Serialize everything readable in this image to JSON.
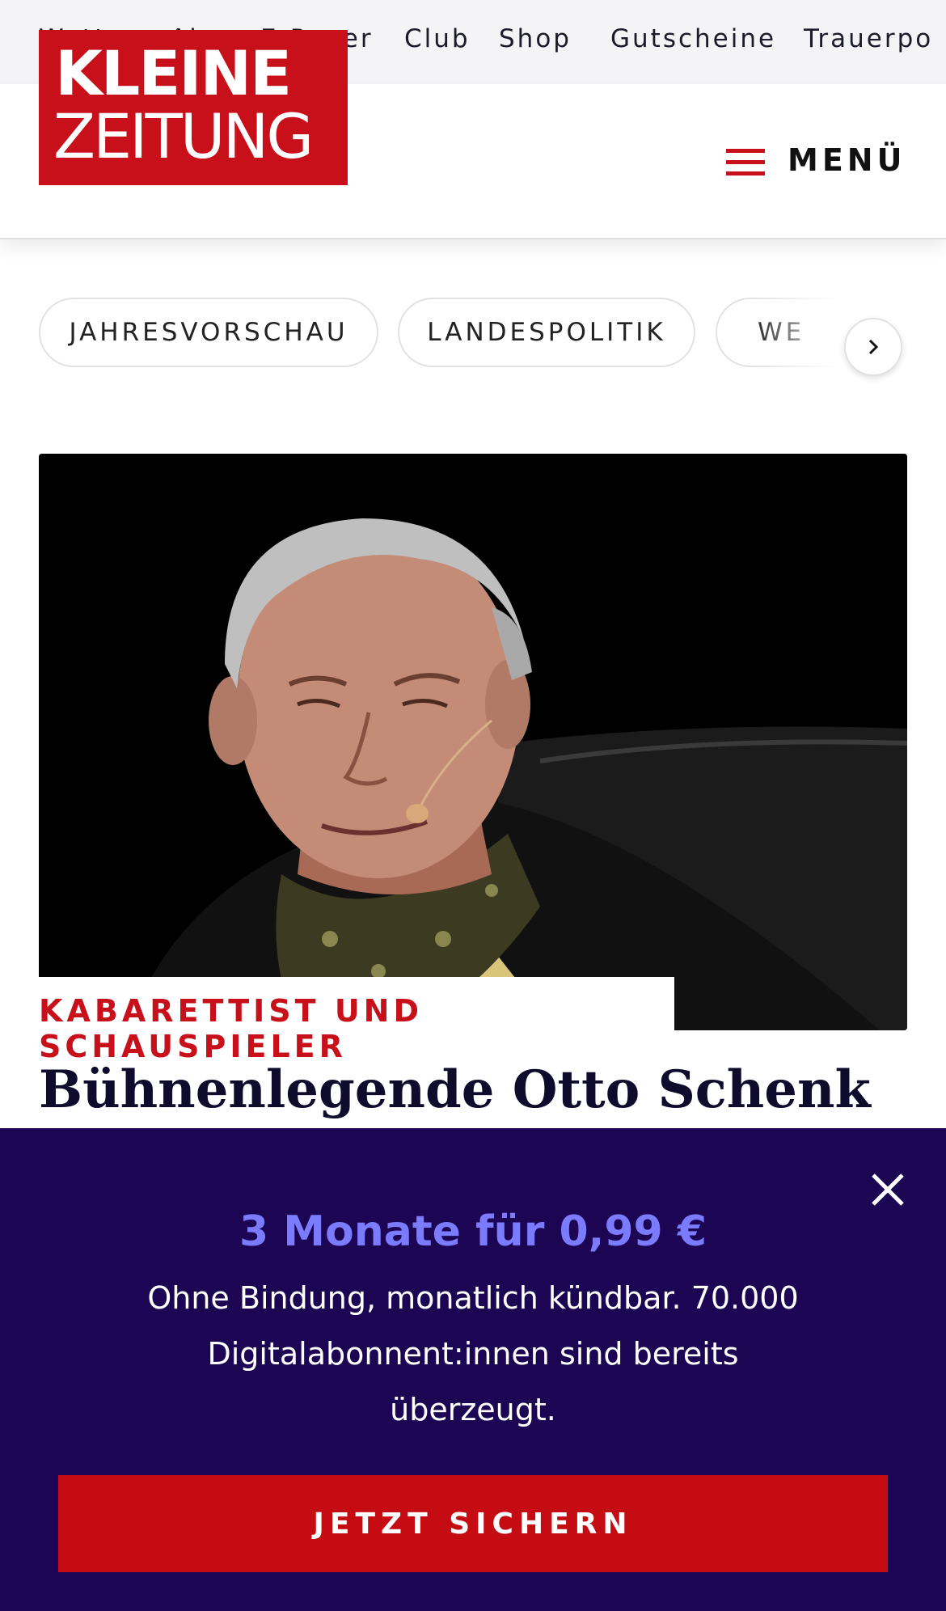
{
  "topnav": {
    "items": [
      "Wetter",
      "Abo",
      "E-Paper",
      "Club",
      "Shop",
      "Gutscheine",
      "Trauerpo"
    ]
  },
  "header": {
    "logo_line1": "KLEINE",
    "logo_line2": "ZEITUNG",
    "menu_label": "MENÜ"
  },
  "chips": [
    "JAHRESVORSCHAU",
    "LANDESPOLITIK",
    "WE"
  ],
  "article": {
    "kicker": "KABARETTIST UND SCHAUSPIELER",
    "headline": "Bühnenlegende Otto Schenk"
  },
  "offer": {
    "title": "3 Monate für 0,99 €",
    "text": "Ohne Bindung, monatlich kündbar. 70.000 Digitalabonnent:innen sind bereits überzeugt.",
    "cta": "JETZT SICHERN"
  },
  "colors": {
    "brand_red": "#c8101a",
    "overlay_bg": "#1c0653",
    "offer_accent": "#7b7bff"
  }
}
